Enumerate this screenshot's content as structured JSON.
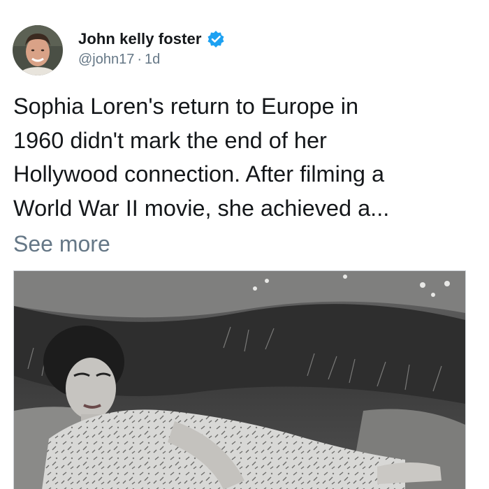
{
  "author": {
    "display_name": "John kelly foster",
    "handle": "@john17",
    "separator": "·",
    "time_ago": "1d",
    "verified_icon": "verified-badge-icon"
  },
  "post": {
    "text": "Sophia Loren's return to Europe in\n1960 didn't mark the end of her\nHollywood connection. After filming a\nWorld War II movie, she achieved a...",
    "see_more_label": "See more"
  },
  "colors": {
    "text_primary": "#14171a",
    "text_secondary": "#657786",
    "verified_blue": "#1da1f2",
    "background": "#ffffff"
  }
}
